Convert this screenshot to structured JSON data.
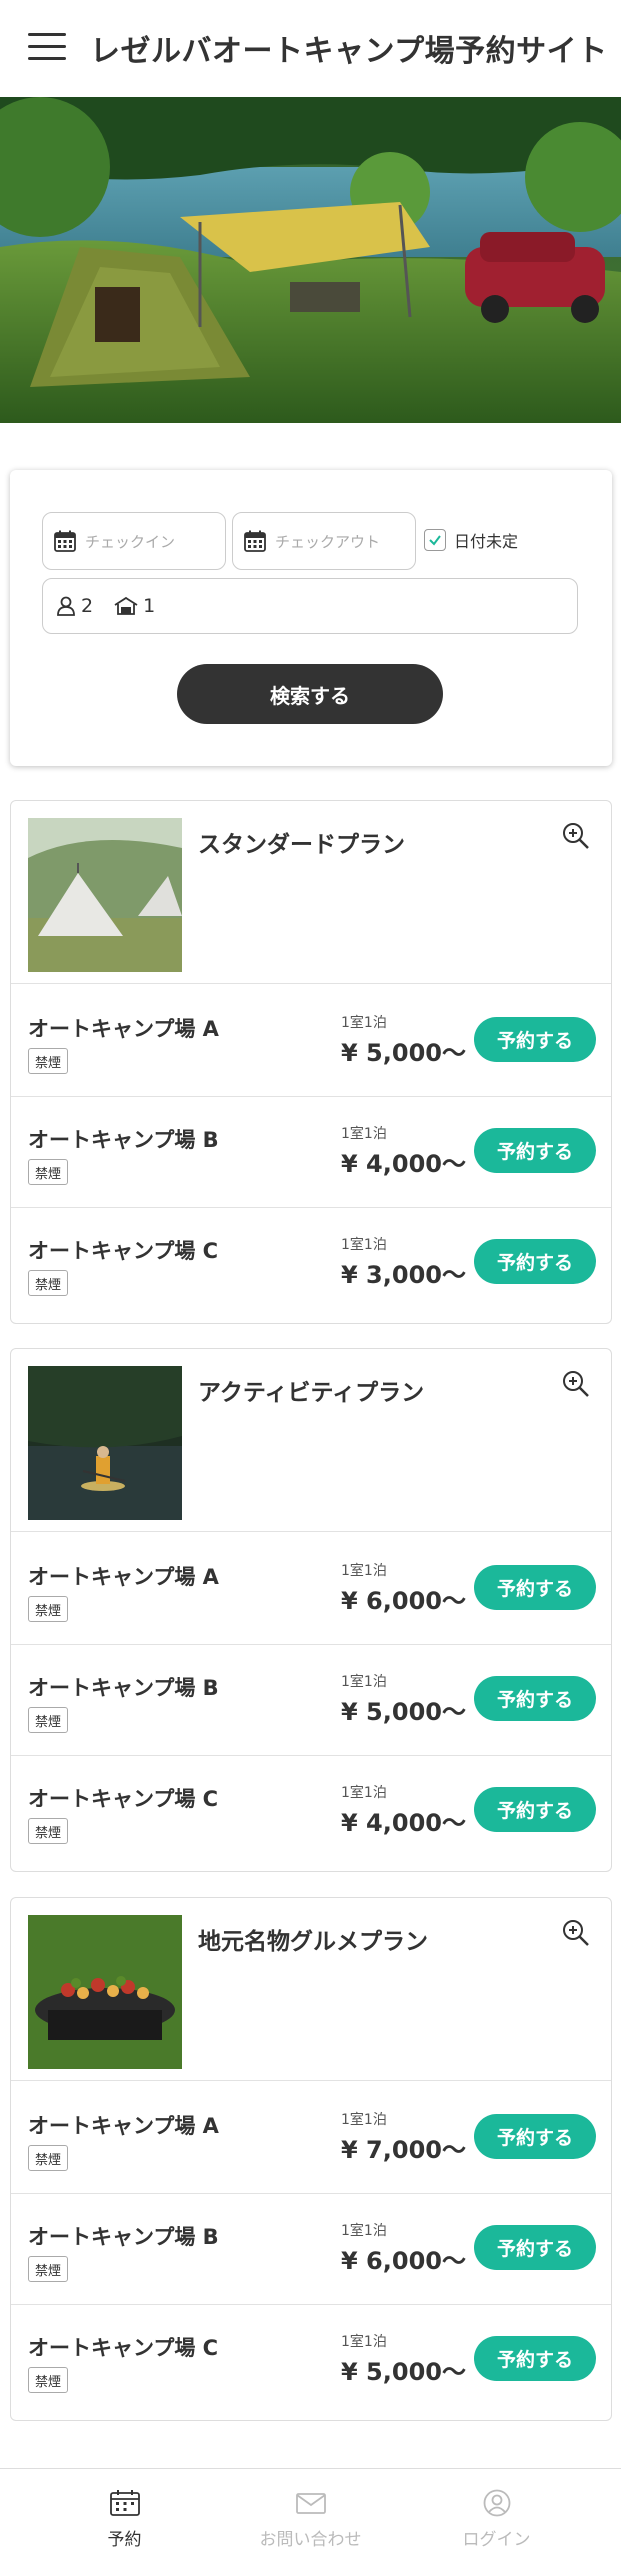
{
  "header": {
    "title": "レゼルバオートキャンプ場予約サイト"
  },
  "search": {
    "checkin_placeholder": "チェックイン",
    "checkout_placeholder": "チェックアウト",
    "undecided_label": "日付未定",
    "undecided_checked": true,
    "adults": "2",
    "rooms": "1",
    "submit_label": "検索する"
  },
  "plans": [
    {
      "title": "スタンダードプラン",
      "sites": [
        {
          "name": "オートキャンプ場 A",
          "badge": "禁煙",
          "per": "1室1泊",
          "price": "¥ 5,000〜",
          "book": "予約する"
        },
        {
          "name": "オートキャンプ場 B",
          "badge": "禁煙",
          "per": "1室1泊",
          "price": "¥ 4,000〜",
          "book": "予約する"
        },
        {
          "name": "オートキャンプ場 C",
          "badge": "禁煙",
          "per": "1室1泊",
          "price": "¥ 3,000〜",
          "book": "予約する"
        }
      ]
    },
    {
      "title": "アクティビティプラン",
      "sites": [
        {
          "name": "オートキャンプ場 A",
          "badge": "禁煙",
          "per": "1室1泊",
          "price": "¥ 6,000〜",
          "book": "予約する"
        },
        {
          "name": "オートキャンプ場 B",
          "badge": "禁煙",
          "per": "1室1泊",
          "price": "¥ 5,000〜",
          "book": "予約する"
        },
        {
          "name": "オートキャンプ場 C",
          "badge": "禁煙",
          "per": "1室1泊",
          "price": "¥ 4,000〜",
          "book": "予約する"
        }
      ]
    },
    {
      "title": "地元名物グルメプラン",
      "sites": [
        {
          "name": "オートキャンプ場 A",
          "badge": "禁煙",
          "per": "1室1泊",
          "price": "¥ 7,000〜",
          "book": "予約する"
        },
        {
          "name": "オートキャンプ場 B",
          "badge": "禁煙",
          "per": "1室1泊",
          "price": "¥ 6,000〜",
          "book": "予約する"
        },
        {
          "name": "オートキャンプ場 C",
          "badge": "禁煙",
          "per": "1室1泊",
          "price": "¥ 5,000〜",
          "book": "予約する"
        }
      ]
    }
  ],
  "nav": [
    {
      "label": "予約",
      "icon": "calendar-icon",
      "active": true
    },
    {
      "label": "お問い合わせ",
      "icon": "mail-icon",
      "active": false
    },
    {
      "label": "ログイン",
      "icon": "user-icon",
      "active": false
    }
  ],
  "colors": {
    "accent": "#1bb89a",
    "dark_button": "#333333"
  }
}
